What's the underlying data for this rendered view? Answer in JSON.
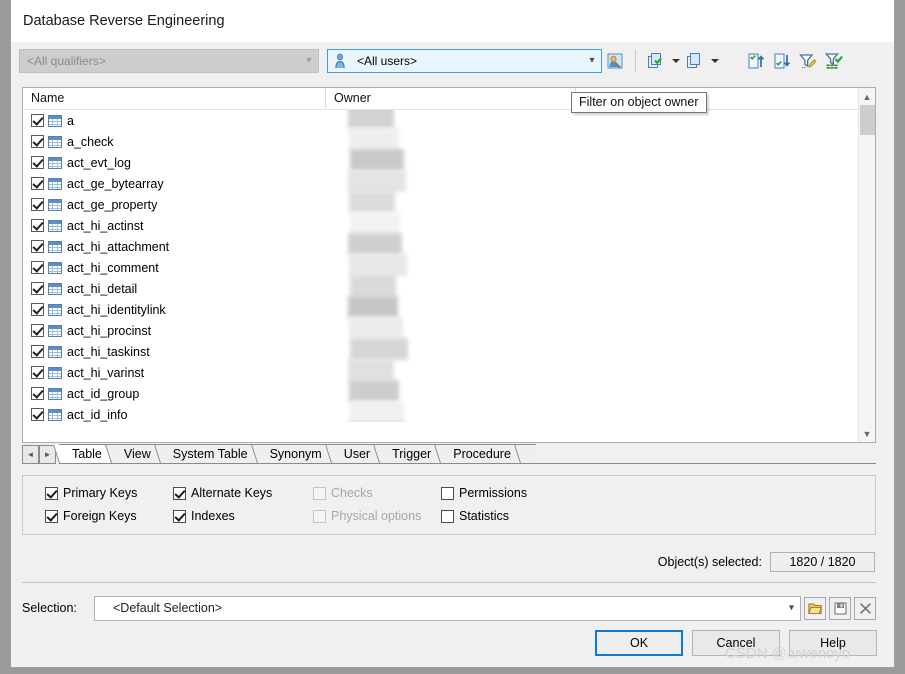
{
  "window": {
    "title": "Database Reverse Engineering"
  },
  "toolbar": {
    "qualifier_combo": {
      "value": "<All qualifiers>",
      "enabled": false
    },
    "user_combo": {
      "value": "<All users>",
      "enabled": true,
      "icon": "user-icon"
    },
    "buttons": [
      {
        "name": "filter-on-object-owner-button",
        "icon": "user-filter-icon"
      },
      {
        "name": "select-all-button",
        "icon": "select-all-icon",
        "has_dropdown": true
      },
      {
        "name": "deselect-all-button",
        "icon": "deselect-all-icon",
        "has_dropdown": true
      },
      {
        "name": "sort-ascending-button",
        "icon": "sort-ascending-icon"
      },
      {
        "name": "sort-descending-button",
        "icon": "sort-descending-icon"
      },
      {
        "name": "edit-filter-button",
        "icon": "filter-pencil-icon"
      },
      {
        "name": "apply-filter-button",
        "icon": "filter-check-icon"
      }
    ]
  },
  "tooltip": {
    "text": "Filter on object owner"
  },
  "list": {
    "columns": [
      "Name",
      "Owner"
    ],
    "rows": [
      {
        "name": "a",
        "checked": true,
        "owner": ""
      },
      {
        "name": "a_check",
        "checked": true,
        "owner": ""
      },
      {
        "name": "act_evt_log",
        "checked": true,
        "owner": ""
      },
      {
        "name": "act_ge_bytearray",
        "checked": true,
        "owner": ""
      },
      {
        "name": "act_ge_property",
        "checked": true,
        "owner": ""
      },
      {
        "name": "act_hi_actinst",
        "checked": true,
        "owner": ""
      },
      {
        "name": "act_hi_attachment",
        "checked": true,
        "owner": ""
      },
      {
        "name": "act_hi_comment",
        "checked": true,
        "owner": ""
      },
      {
        "name": "act_hi_detail",
        "checked": true,
        "owner": ""
      },
      {
        "name": "act_hi_identitylink",
        "checked": true,
        "owner": ""
      },
      {
        "name": "act_hi_procinst",
        "checked": true,
        "owner": ""
      },
      {
        "name": "act_hi_taskinst",
        "checked": true,
        "owner": ""
      },
      {
        "name": "act_hi_varinst",
        "checked": true,
        "owner": ""
      },
      {
        "name": "act_id_group",
        "checked": true,
        "owner": ""
      },
      {
        "name": "act_id_info",
        "checked": true,
        "owner": ""
      }
    ],
    "scrollbar": {
      "up": "▲",
      "down": "▼"
    }
  },
  "tabs": {
    "nav_left": "◄",
    "nav_right": "►",
    "items": [
      {
        "label": "Table",
        "active": true
      },
      {
        "label": "View",
        "active": false
      },
      {
        "label": "System Table",
        "active": false
      },
      {
        "label": "Synonym",
        "active": false
      },
      {
        "label": "User",
        "active": false
      },
      {
        "label": "Trigger",
        "active": false
      },
      {
        "label": "Procedure",
        "active": false
      }
    ]
  },
  "options": [
    {
      "label": "Primary Keys",
      "checked": true,
      "enabled": true,
      "col": 0,
      "row": 0
    },
    {
      "label": "Foreign Keys",
      "checked": true,
      "enabled": true,
      "col": 0,
      "row": 1
    },
    {
      "label": "Alternate Keys",
      "checked": true,
      "enabled": true,
      "col": 1,
      "row": 0
    },
    {
      "label": "Indexes",
      "checked": true,
      "enabled": true,
      "col": 1,
      "row": 1
    },
    {
      "label": "Checks",
      "checked": false,
      "enabled": false,
      "col": 2,
      "row": 0
    },
    {
      "label": "Physical options",
      "checked": false,
      "enabled": false,
      "col": 2,
      "row": 1
    },
    {
      "label": "Permissions",
      "checked": false,
      "enabled": true,
      "col": 3,
      "row": 0
    },
    {
      "label": "Statistics",
      "checked": false,
      "enabled": true,
      "col": 3,
      "row": 1
    }
  ],
  "status": {
    "objects_label": "Object(s) selected:",
    "objects_value": "1820 / 1820"
  },
  "selection": {
    "label": "Selection:",
    "value": "<Default Selection>",
    "buttons": [
      {
        "name": "open-selection-button",
        "icon": "folder-icon"
      },
      {
        "name": "save-selection-button",
        "icon": "save-icon"
      },
      {
        "name": "delete-selection-button",
        "icon": "close-x-icon"
      }
    ]
  },
  "dialog_buttons": [
    {
      "label": "OK",
      "default": true
    },
    {
      "label": "Cancel",
      "default": false
    },
    {
      "label": "Help",
      "default": false
    }
  ],
  "watermark": {
    "text": "CSDN @aiwenoyo"
  },
  "colors": {
    "accent": "#0d7ad4",
    "focus_field": "#eaf6fd",
    "window_bg": "#f0f0f0",
    "desktop": "#9a9a9a"
  }
}
